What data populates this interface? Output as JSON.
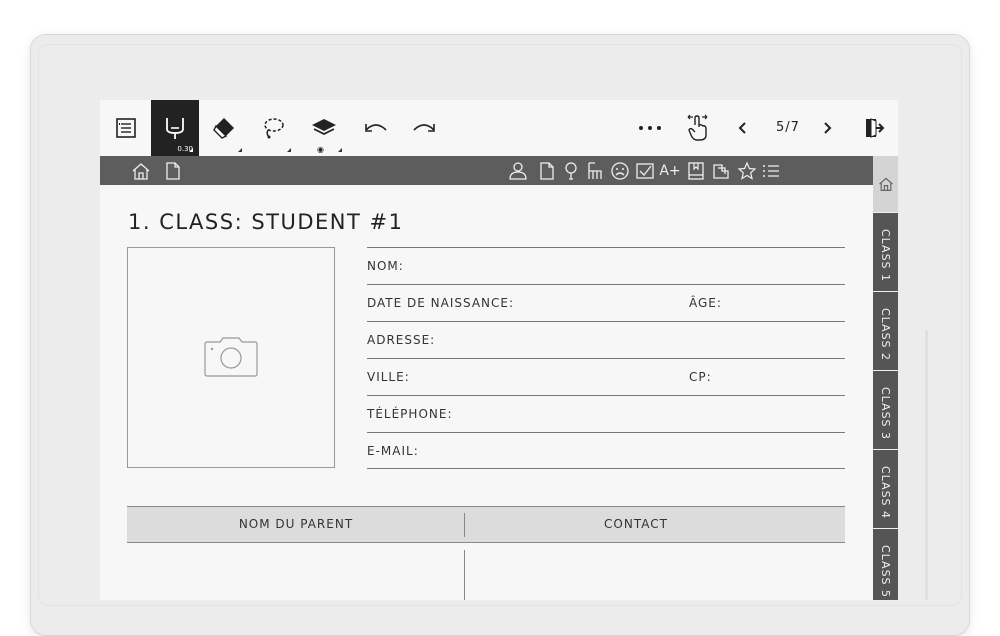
{
  "toolbar": {
    "tools": [
      {
        "name": "list-icon"
      },
      {
        "name": "pen-icon",
        "badge": "0.30",
        "active": true
      },
      {
        "name": "eraser-icon"
      },
      {
        "name": "lasso-icon"
      },
      {
        "name": "layers-icon"
      },
      {
        "name": "undo-icon"
      },
      {
        "name": "redo-icon"
      }
    ],
    "right": {
      "more": "more-icon",
      "touch": "touch-gesture-icon",
      "prev": "chevron-left-icon",
      "page": "5/7",
      "next": "chevron-right-icon",
      "exit": "exit-icon"
    }
  },
  "navbar": {
    "left_icons": [
      "home-icon",
      "document-icon"
    ],
    "right_icons": [
      "person-icon",
      "document-icon",
      "bulb-icon",
      "chair-icon",
      "sad-face-icon",
      "checkbox-icon",
      "grade-icon",
      "book-icon",
      "clipboard-icon",
      "star-icon",
      "list-icon"
    ]
  },
  "tabs": {
    "home_icon": "home-icon",
    "items": [
      "CLASS 1",
      "CLASS 2",
      "CLASS 3",
      "CLASS 4",
      "CLASS 5"
    ]
  },
  "form": {
    "title": "1. CLASS: STUDENT #1",
    "photo_icon": "camera-icon",
    "fields": [
      {
        "label": "NOM:"
      },
      {
        "label": "DATE DE NAISSANCE:",
        "label2": "ÂGE:"
      },
      {
        "label": "ADRESSE:"
      },
      {
        "label": "VILLE:",
        "label2": "CP:"
      },
      {
        "label": "TÉLÉPHONE:"
      },
      {
        "label": "E-MAIL:"
      }
    ],
    "parent_table": {
      "col1": "NOM DU PARENT",
      "col2": "CONTACT"
    }
  },
  "colors": {
    "navbar_bg": "#5d5d5d",
    "active_tool_bg": "#222222",
    "tab_bg": "#555555",
    "header_bg": "#dcdcdc",
    "screen_bg": "#f7f7f7"
  }
}
